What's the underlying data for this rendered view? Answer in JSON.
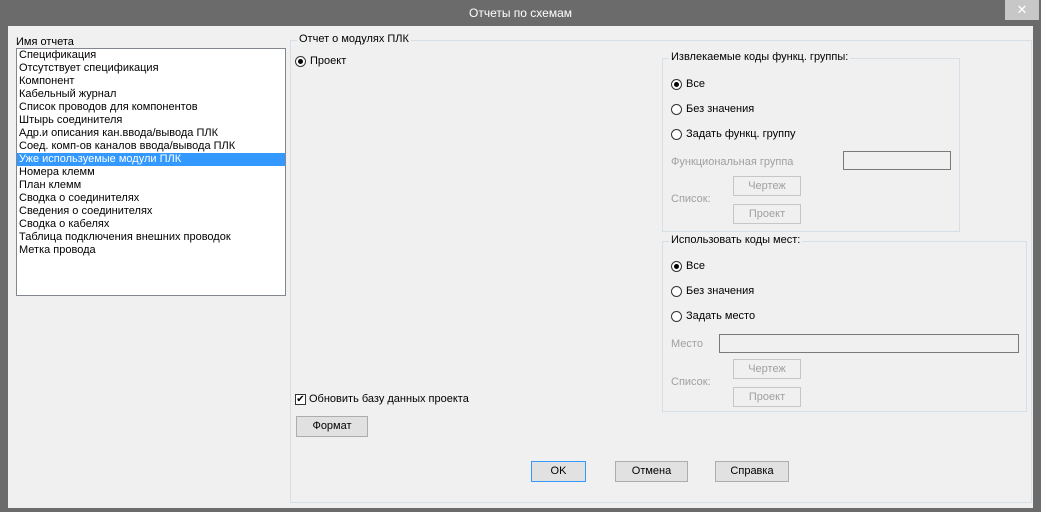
{
  "window": {
    "title": "Отчеты по схемам",
    "close": "✕"
  },
  "left": {
    "label": "Имя отчета",
    "items": [
      "Спецификация",
      "Отсутствует спецификация",
      "Компонент",
      "Кабельный журнал",
      "Список проводов для компонентов",
      "Штырь соединителя",
      "Адр.и описания кан.ввода/вывода ПЛК",
      "Соед. комп-ов каналов ввода/вывода ПЛК",
      "Уже используемые модули ПЛК",
      "Номера клемм",
      "План клемм",
      "Сводка о соединителях",
      "Сведения о соединителях",
      "Сводка о кабелях",
      "Таблица подключения внешних проводок",
      "Метка провода"
    ],
    "selected_index": 8
  },
  "main": {
    "group_title": "Отчет о модулях ПЛК",
    "project_radio": "Проект",
    "update_db": "Обновить базу данных проекта",
    "format_button": "Формат"
  },
  "func_group": {
    "title": "Извлекаемые коды функц. группы:",
    "opt_all": "Все",
    "opt_none": "Без значения",
    "opt_set": "Задать функц. группу",
    "field_label": "Функциональная группа",
    "list_label": "Список:",
    "drawing_btn": "Чертеж",
    "project_btn": "Проект"
  },
  "location": {
    "title": "Использовать коды мест:",
    "opt_all": "Все",
    "opt_none": "Без значения",
    "opt_set": "Задать место",
    "field_label": "Место",
    "list_label": "Список:",
    "drawing_btn": "Чертеж",
    "project_btn": "Проект"
  },
  "footer": {
    "ok": "OK",
    "cancel": "Отмена",
    "help": "Справка"
  }
}
